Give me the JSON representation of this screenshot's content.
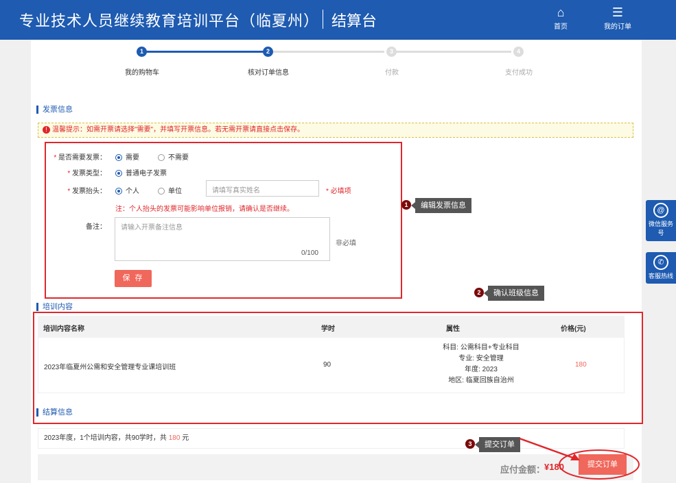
{
  "header": {
    "title": "专业技术人员继续教育培训平台（临夏州）",
    "subtitle": "结算台",
    "nav": [
      {
        "label": "首页",
        "icon": "home-icon"
      },
      {
        "label": "我的订单",
        "icon": "order-icon"
      }
    ]
  },
  "steps": [
    {
      "num": "1",
      "label": "我的购物车",
      "state": "done"
    },
    {
      "num": "2",
      "label": "核对订单信息",
      "state": "active"
    },
    {
      "num": "3",
      "label": "付款",
      "state": "pending"
    },
    {
      "num": "4",
      "label": "支付成功",
      "state": "pending"
    }
  ],
  "invoice": {
    "section_title": "发票信息",
    "notice": "温馨提示：如需开票请选择\"需要\"，并填写开票信息。若无需开票请直接点击保存。",
    "need_label": "是否需要发票：",
    "need_options": [
      "需要",
      "不需要"
    ],
    "need_selected": "需要",
    "type_label": "发票类型：",
    "type_value": "普通电子发票",
    "header_label": "发票抬头：",
    "header_options": [
      "个人",
      "单位"
    ],
    "header_selected": "个人",
    "name_placeholder": "请填写真实姓名",
    "required_hint": "* 必填项",
    "personal_warning": "注：个人抬头的发票可能影响单位报销，请确认是否继续。",
    "remark_label": "备注：",
    "remark_placeholder": "请输入开票备注信息",
    "remark_counter": "0/100",
    "optional_hint": "非必填",
    "save_label": "保 存"
  },
  "training": {
    "section_title": "培训内容",
    "columns": [
      "培训内容名称",
      "学时",
      "属性",
      "价格(元)"
    ],
    "rows": [
      {
        "name": "2023年临夏州公需和安全管理专业课培训班",
        "hours": "90",
        "attrs": [
          "科目: 公需科目+专业科目",
          "专业: 安全管理",
          "年度: 2023",
          "地区: 临夏回族自治州"
        ],
        "price": "180"
      }
    ]
  },
  "settlement": {
    "section_title": "结算信息",
    "summary_prefix": "2023年度，1个培训内容，共90学时，共",
    "summary_amount": "180",
    "summary_suffix": "元",
    "pay_label": "应付金额：",
    "pay_amount": "¥180",
    "submit_label": "提交订单"
  },
  "callouts": [
    {
      "num": "1",
      "text": "编辑发票信息"
    },
    {
      "num": "2",
      "text": "确认班级信息"
    },
    {
      "num": "3",
      "text": "提交订单"
    }
  ],
  "side": [
    {
      "label": "微信服务号",
      "icon": "wechat-icon"
    },
    {
      "label": "客服热线",
      "icon": "phone-icon"
    }
  ],
  "colors": {
    "brand": "#1e5bb1",
    "accent": "#f0675b",
    "alert": "#e0262b"
  }
}
